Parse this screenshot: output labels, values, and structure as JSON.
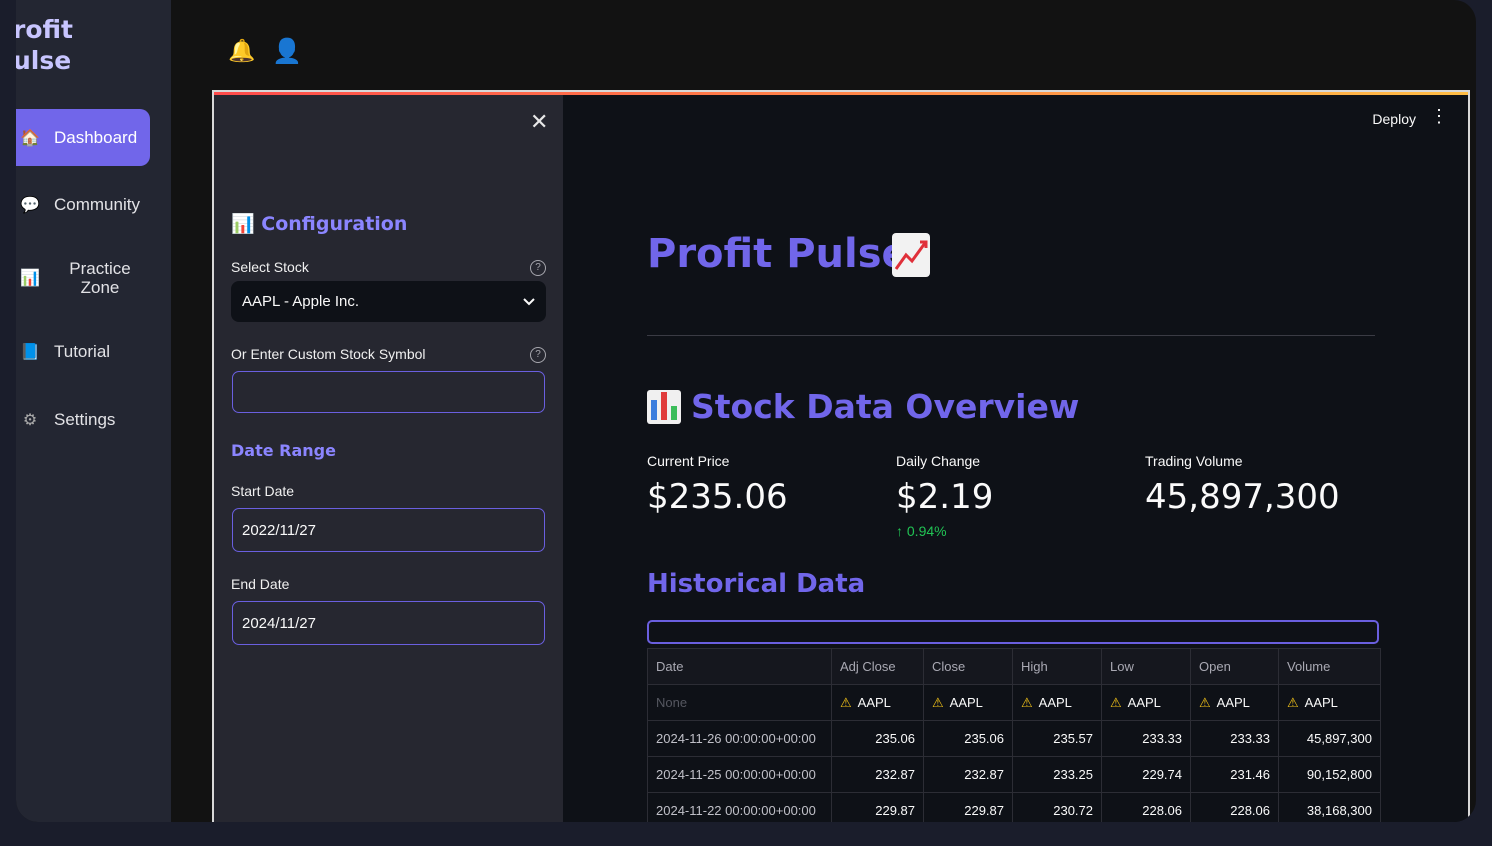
{
  "brand": {
    "line1": "rofit",
    "line2": "ulse"
  },
  "nav": [
    {
      "label": "Dashboard",
      "icon": "home-icon",
      "glyph": "🏠"
    },
    {
      "label": "Community",
      "icon": "speech-bubble-icon",
      "glyph": "💬"
    },
    {
      "label": "Practice Zone",
      "icon": "bar-chart-icon",
      "glyph": "📊"
    },
    {
      "label": "Tutorial",
      "icon": "book-icon",
      "glyph": "📘"
    },
    {
      "label": "Settings",
      "icon": "gear-icon",
      "glyph": "⚙"
    }
  ],
  "topbar": {
    "bell_glyph": "🔔",
    "user_glyph": "👤"
  },
  "header": {
    "deploy": "Deploy",
    "menu_glyph": "⋮"
  },
  "sidebar": {
    "close_glyph": "✕",
    "config_title": "📊 Configuration",
    "select_stock_label": "Select Stock",
    "select_stock_value": "AAPL - Apple Inc.",
    "custom_label": "Or Enter Custom Stock Symbol",
    "custom_value": "",
    "date_range": "Date Range",
    "start_label": "Start Date",
    "start_value": "2022/11/27",
    "end_label": "End Date",
    "end_value": "2024/11/27",
    "help_glyph": "?"
  },
  "main": {
    "title": "Profit Pulse",
    "overview": "Stock Data Overview",
    "metrics": [
      {
        "label": "Current Price",
        "value": "$235.06"
      },
      {
        "label": "Daily Change",
        "value": "$2.19",
        "delta": "0.94%"
      },
      {
        "label": "Trading Volume",
        "value": "45,897,300"
      }
    ],
    "historical": "Historical Data"
  },
  "table": {
    "columns": [
      "Date",
      "Adj Close",
      "Close",
      "High",
      "Low",
      "Open",
      "Volume"
    ],
    "ticker_row": {
      "date": "None",
      "ticker": "AAPL"
    },
    "rows": [
      [
        "2024-11-26 00:00:00+00:00",
        "235.06",
        "235.06",
        "235.57",
        "233.33",
        "233.33",
        "45,897,300"
      ],
      [
        "2024-11-25 00:00:00+00:00",
        "232.87",
        "232.87",
        "233.25",
        "229.74",
        "231.46",
        "90,152,800"
      ],
      [
        "2024-11-22 00:00:00+00:00",
        "229.87",
        "229.87",
        "230.72",
        "228.06",
        "228.06",
        "38,168,300"
      ]
    ]
  },
  "colors": {
    "accent": "#7166ea",
    "positive": "#21c354",
    "warning": "#f5c518"
  }
}
